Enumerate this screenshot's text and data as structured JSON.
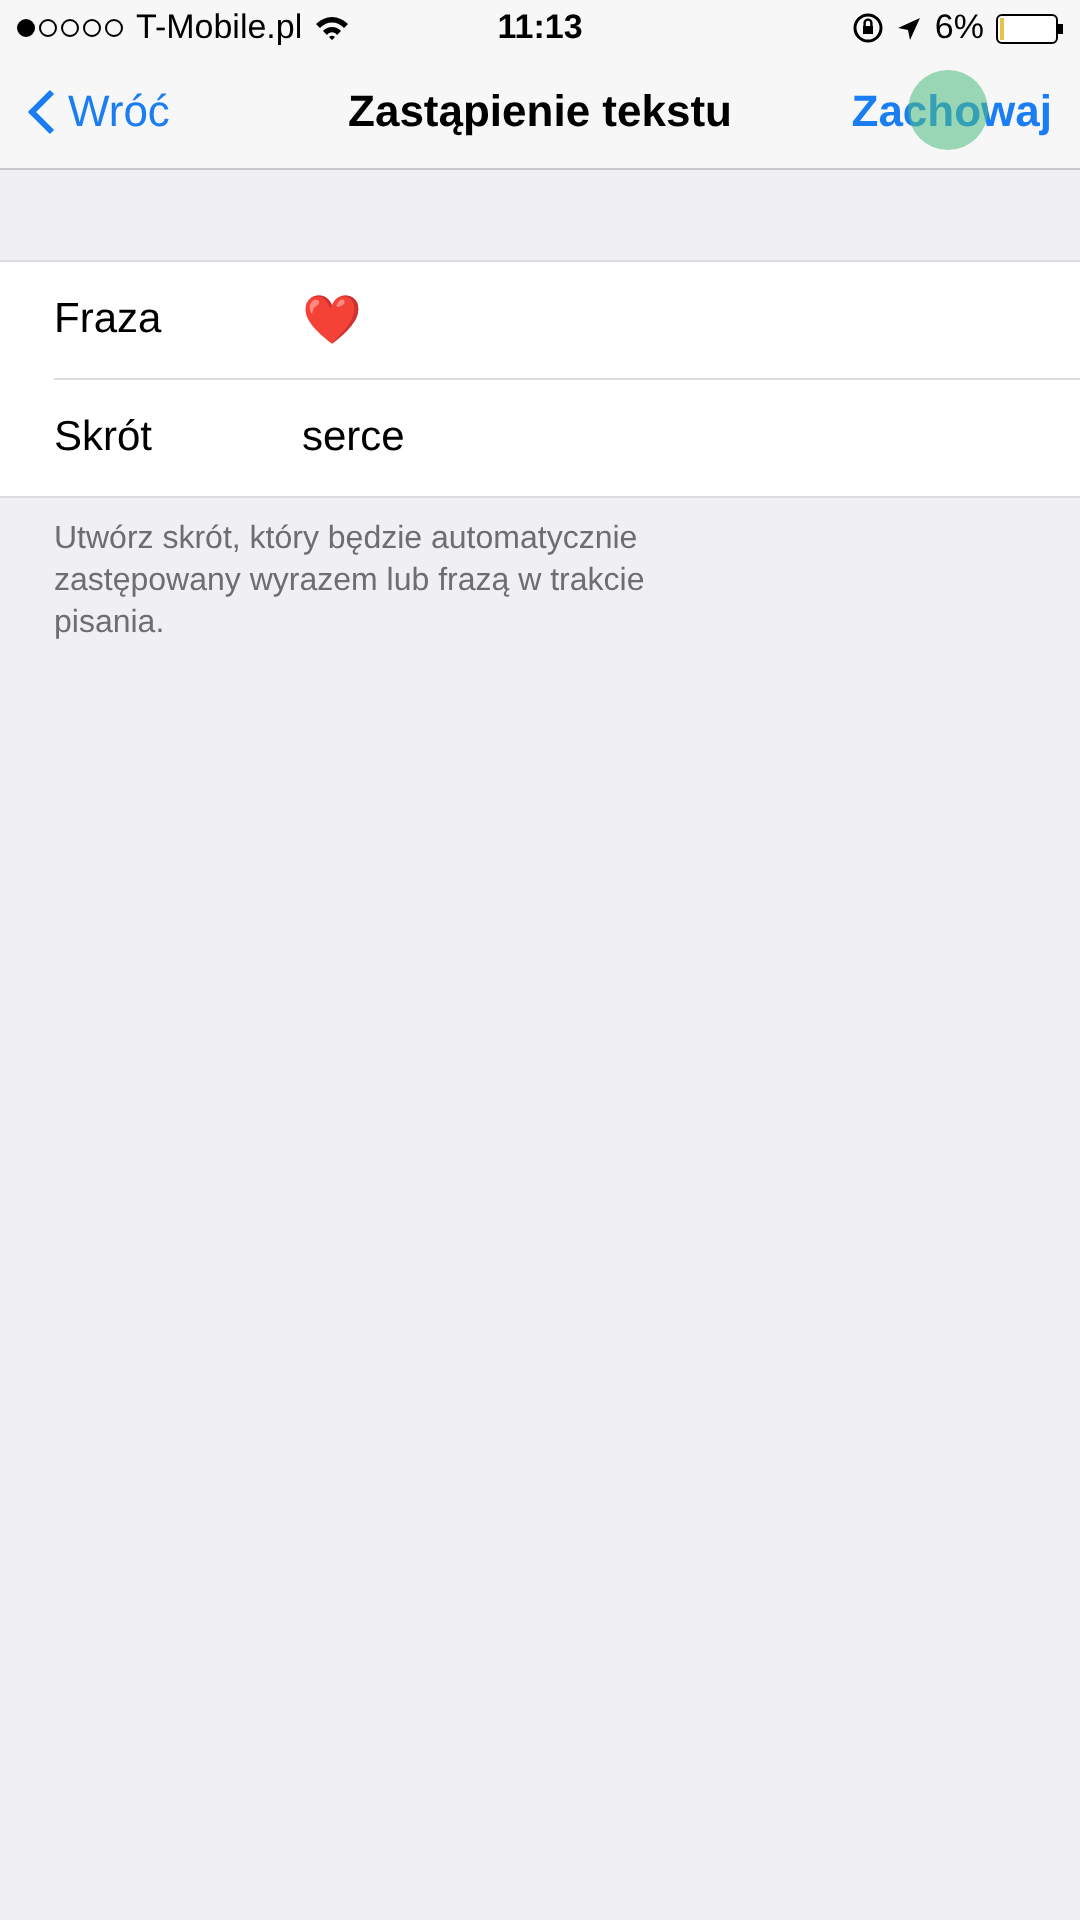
{
  "status_bar": {
    "carrier": "T-Mobile.pl",
    "time": "11:13",
    "battery": "6%"
  },
  "nav_bar": {
    "back": "Wróć",
    "title": "Zastąpienie tekstu",
    "save": "Zachowaj",
    "touch_indicator": true
  },
  "fields": [
    {
      "label": "Fraza",
      "value": "❤️",
      "kind": "emoji"
    },
    {
      "label": "Skrót",
      "value": "serce",
      "kind": "text"
    }
  ],
  "footer": "Utwórz skrót, który będzie automatycznie zastępowany wyrazem lub frazą w trakcie pisania."
}
